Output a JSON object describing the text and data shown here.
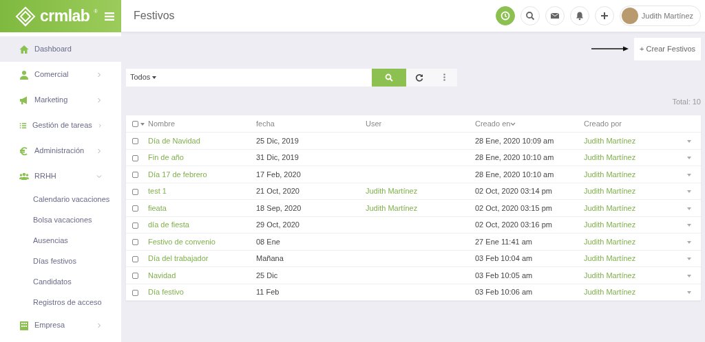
{
  "brand": {
    "name": "crmlab",
    "mark": "®"
  },
  "header": {
    "title": "Festivos",
    "user": "Judith Martínez"
  },
  "sidebar": {
    "items": [
      {
        "label": "Dashboard",
        "kind": "link",
        "selected": true
      },
      {
        "label": "Comercial",
        "kind": "group",
        "selected": false,
        "expanded": false
      },
      {
        "label": "Marketing",
        "kind": "group",
        "selected": false,
        "expanded": false
      },
      {
        "label": "Gestión de tareas",
        "kind": "group",
        "selected": false,
        "expanded": false
      },
      {
        "label": "Administración",
        "kind": "group",
        "selected": false,
        "expanded": false
      },
      {
        "label": "RRHH",
        "kind": "group",
        "selected": false,
        "expanded": true,
        "children": [
          {
            "label": "Calendario vacaciones"
          },
          {
            "label": "Bolsa vacaciones"
          },
          {
            "label": "Ausencias"
          },
          {
            "label": "Días festivos"
          },
          {
            "label": "Candidatos"
          },
          {
            "label": "Registros de acceso"
          }
        ]
      },
      {
        "label": "Empresa",
        "kind": "group",
        "selected": false,
        "expanded": false
      }
    ]
  },
  "create_button": "+ Crear Festivos",
  "filter": {
    "dropdown": "Todos"
  },
  "total": "Total: 10",
  "table": {
    "all_checked": false,
    "columns": [
      "Nombre",
      "fecha",
      "User",
      "Creado en",
      "Creado por"
    ],
    "rows": [
      {
        "checked": false,
        "cells": [
          "Día de Navidad",
          "25 Dic, 2019",
          "",
          "28 Ene, 2020 10:09 am",
          "Judith Martínez"
        ]
      },
      {
        "checked": false,
        "cells": [
          "Fin de año",
          "31 Dic, 2019",
          "",
          "28 Ene, 2020 10:10 am",
          "Judith Martínez"
        ]
      },
      {
        "checked": false,
        "cells": [
          "Día 17 de febrero",
          "17 Feb, 2020",
          "",
          "28 Ene, 2020 10:10 am",
          "Judith Martínez"
        ]
      },
      {
        "checked": false,
        "cells": [
          "test 1",
          "21 Oct, 2020",
          "Judith Martínez",
          "02 Oct, 2020 03:14 pm",
          "Judith Martínez"
        ]
      },
      {
        "checked": false,
        "cells": [
          "fieata",
          "18 Sep, 2020",
          "Judith Martínez",
          "02 Oct, 2020 03:15 pm",
          "Judith Martínez"
        ]
      },
      {
        "checked": false,
        "cells": [
          "día de fiesta",
          "29 Oct, 2020",
          "",
          "02 Oct, 2020 03:16 pm",
          "Judith Martínez"
        ]
      },
      {
        "checked": false,
        "cells": [
          "Festivo de convenio",
          "08 Ene",
          "",
          "27 Ene 11:41 am",
          "Judith Martínez"
        ]
      },
      {
        "checked": false,
        "cells": [
          "Día del trabajador",
          "Mañana",
          "",
          "03 Feb 10:04 am",
          "Judith Martínez"
        ]
      },
      {
        "checked": false,
        "cells": [
          "Navidad",
          "25 Dic",
          "",
          "03 Feb 10:05 am",
          "Judith Martínez"
        ]
      },
      {
        "checked": false,
        "cells": [
          "Día festivo",
          "11 Feb",
          "",
          "03 Feb 10:06 am",
          "Judith Martínez"
        ]
      }
    ]
  }
}
